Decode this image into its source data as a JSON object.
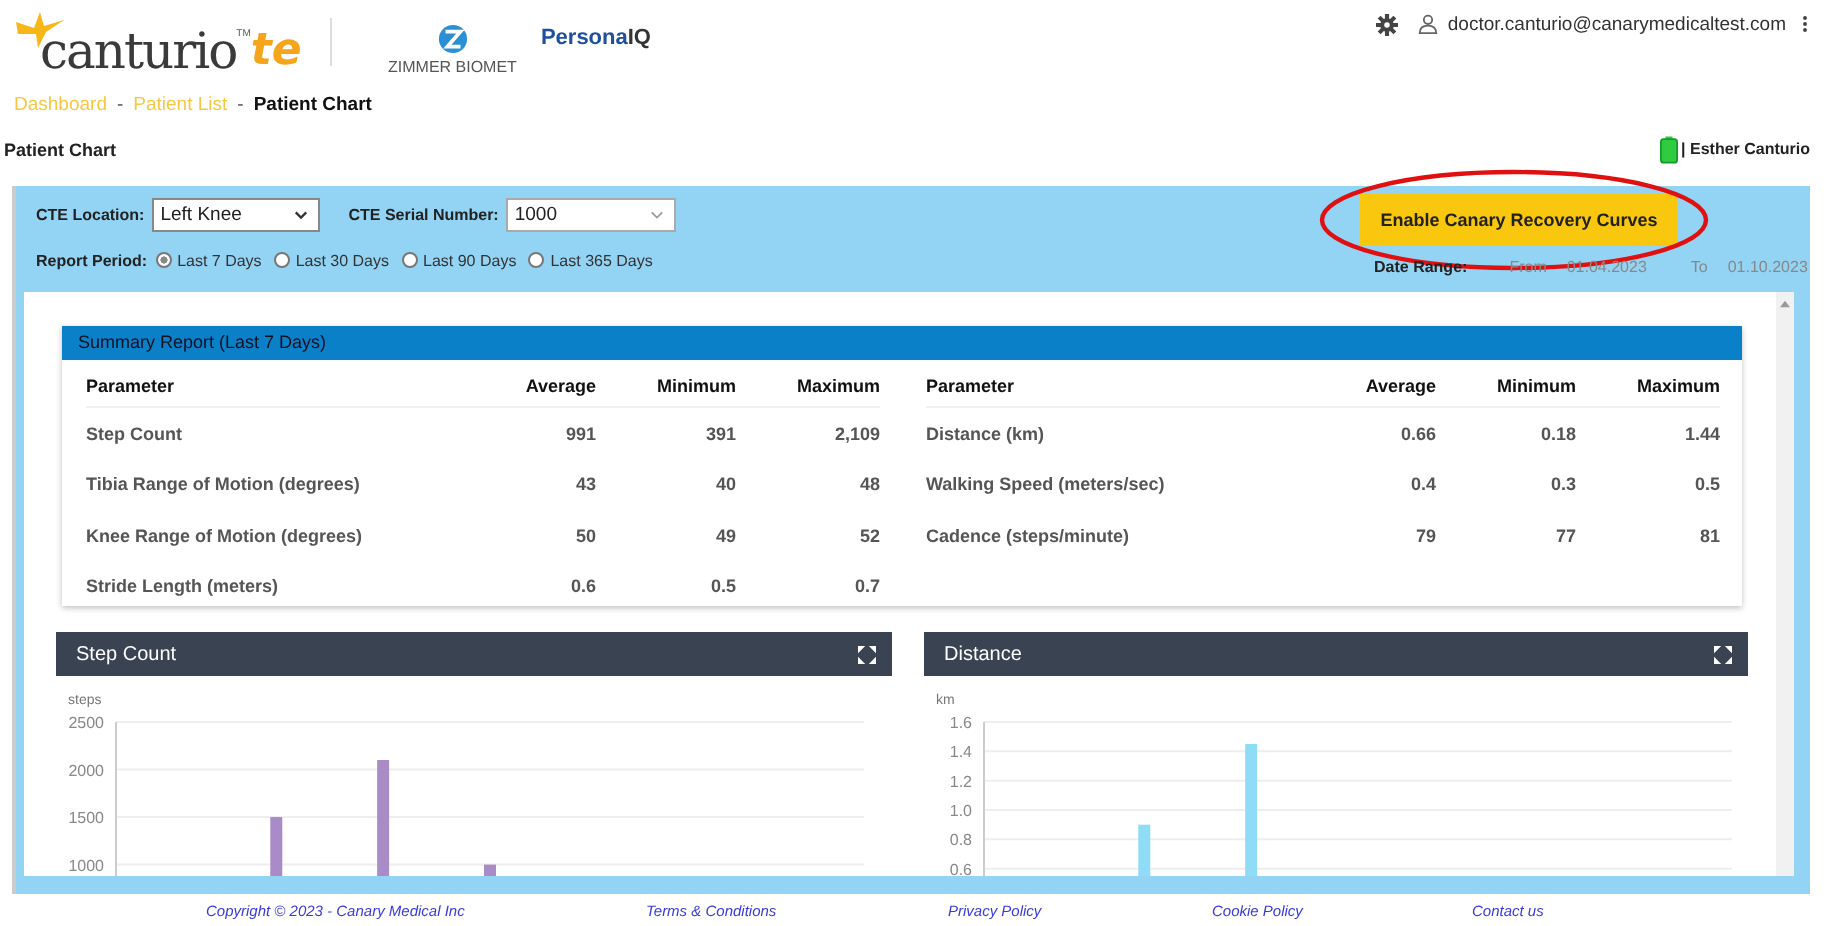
{
  "header": {
    "logo": {
      "name": "canturio",
      "tm": "TM",
      "suffix": "te"
    },
    "partner_logos": [
      {
        "kind": "zimmer",
        "text": "ZIMMER BIOMET"
      },
      {
        "kind": "persona",
        "text": "Persona",
        "suffix": "IQ"
      }
    ],
    "user_email": "doctor.canturio@canarymedicaltest.com"
  },
  "breadcrumbs": [
    {
      "label": "Dashboard",
      "current": false
    },
    {
      "label": "Patient List",
      "current": false
    },
    {
      "label": "Patient Chart",
      "current": true
    }
  ],
  "breadcrumb_separator": "-",
  "page_title": "Patient Chart",
  "patient": {
    "name": "| Esther Canturio"
  },
  "filters": {
    "location": {
      "label": "CTE Location:",
      "value": "Left Knee"
    },
    "serial": {
      "label": "CTE Serial Number:",
      "value": "1000"
    },
    "report_period": {
      "label": "Report Period:",
      "options": [
        {
          "label": "Last 7 Days",
          "selected": true
        },
        {
          "label": "Last 30 Days",
          "selected": false
        },
        {
          "label": "Last 90 Days",
          "selected": false
        },
        {
          "label": "Last 365 Days",
          "selected": false
        }
      ]
    }
  },
  "recovery_button": {
    "label": "Enable Canary Recovery Curves",
    "circled": true
  },
  "date_range": {
    "label": "Date Range:",
    "from_label": "From",
    "from": "01.04.2023",
    "to_label": "To",
    "to": "01.10.2023"
  },
  "summary": {
    "title": "Summary Report (Last 7 Days)",
    "left_columns": [
      "Parameter",
      "Average",
      "Minimum",
      "Maximum"
    ],
    "right_columns": [
      "Parameter",
      "Average",
      "Minimum",
      "Maximum"
    ],
    "left_rows": [
      [
        "Step Count",
        "991",
        "391",
        "2,109"
      ],
      [
        "Tibia Range of Motion (degrees)",
        "43",
        "40",
        "48"
      ],
      [
        "Knee Range of Motion (degrees)",
        "50",
        "49",
        "52"
      ],
      [
        "Stride Length (meters)",
        "0.6",
        "0.5",
        "0.7"
      ]
    ],
    "right_rows": [
      [
        "Distance (km)",
        "0.66",
        "0.18",
        "1.44"
      ],
      [
        "Walking Speed (meters/sec)",
        "0.4",
        "0.3",
        "0.5"
      ],
      [
        "Cadence (steps/minute)",
        "79",
        "77",
        "81"
      ]
    ]
  },
  "charts": [
    {
      "title": "Step Count",
      "chart_data": {
        "type": "bar",
        "grid": true,
        "ylabel": "steps",
        "ylim": [
          880,
          2500
        ],
        "yticks": [
          1000,
          1500,
          2000,
          2500
        ],
        "series": [
          {
            "color": "#a98bc8",
            "values": [
              null,
              1500,
              2100,
              1000,
              null,
              null,
              null
            ]
          }
        ]
      }
    },
    {
      "title": "Distance",
      "chart_data": {
        "type": "bar",
        "grid": true,
        "ylabel": "km",
        "ylim": [
          0.55,
          1.6
        ],
        "yticks": [
          {
            "value": 0.6,
            "label": "0.6"
          },
          {
            "value": 0.8,
            "label": "0.8"
          },
          {
            "value": 1.0,
            "label": "1.0"
          },
          {
            "value": 1.2,
            "label": "1.2"
          },
          {
            "value": 1.4,
            "label": "1.4"
          },
          {
            "value": 1.6,
            "label": "1.6"
          }
        ],
        "series": [
          {
            "color": "#8fdcf7",
            "values": [
              null,
              0.9,
              1.45,
              null,
              null,
              null,
              null
            ]
          }
        ]
      }
    }
  ],
  "footer": {
    "links": [
      "Copyright © 2023 - Canary Medical Inc",
      "Terms & Conditions",
      "Privacy Policy",
      "Cookie Policy",
      "Contact us"
    ]
  }
}
